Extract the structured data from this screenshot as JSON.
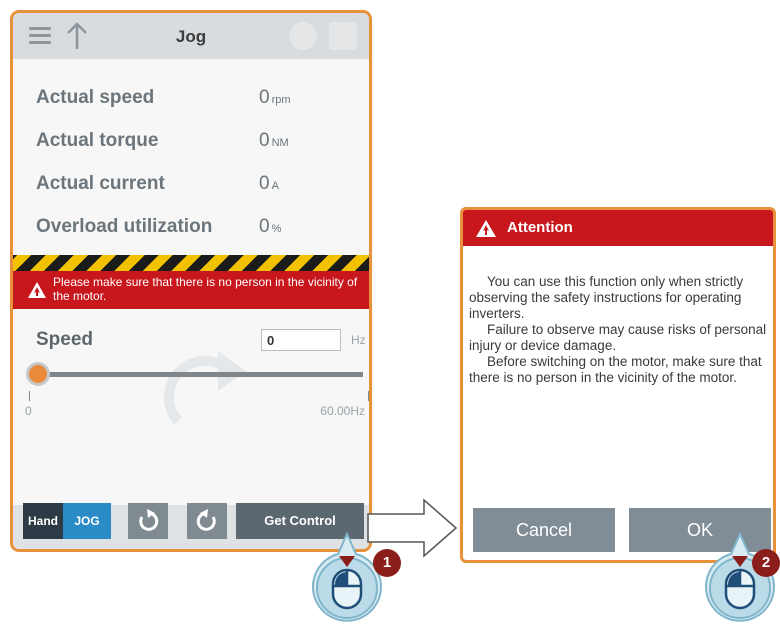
{
  "header": {
    "title": "Jog"
  },
  "readouts": [
    {
      "label": "Actual speed",
      "value": "0",
      "unit": "rpm"
    },
    {
      "label": "Actual torque",
      "value": "0",
      "unit": "NM"
    },
    {
      "label": "Actual current",
      "value": "0",
      "unit": "A"
    },
    {
      "label": "Overload utilization",
      "value": "0",
      "unit": "%"
    }
  ],
  "warning": {
    "text": "Please make sure that there is no person in the vicinity of the motor."
  },
  "speed": {
    "label": "Speed",
    "input_value": "0",
    "unit": "Hz",
    "min_label": "0",
    "max_label": "60.00Hz",
    "slider_fraction": 0.0
  },
  "bottom": {
    "hand": "Hand",
    "jog": "JOG",
    "get_control": "Get Control"
  },
  "dialog": {
    "title": "Attention",
    "paragraphs": [
      "You can use this function only when strictly observing the safety instructions for operating inverters.",
      "Failure to observe may cause risks of personal injury or device damage.",
      "Before switching on the motor, make sure that there is no person in the vicinity of the motor."
    ],
    "cancel": "Cancel",
    "ok": "OK"
  },
  "steps": {
    "one": "1",
    "two": "2"
  },
  "colors": {
    "accent": "#e8913a",
    "danger": "#c8161d",
    "jog_blue": "#2a8cc7",
    "knob": "#e98a3b"
  },
  "icons": [
    "menu-icon",
    "up-arrow-icon",
    "warning-icon",
    "rotate-cw-icon",
    "rotate-ccw-icon",
    "mouse-icon",
    "arrow-right-icon"
  ]
}
